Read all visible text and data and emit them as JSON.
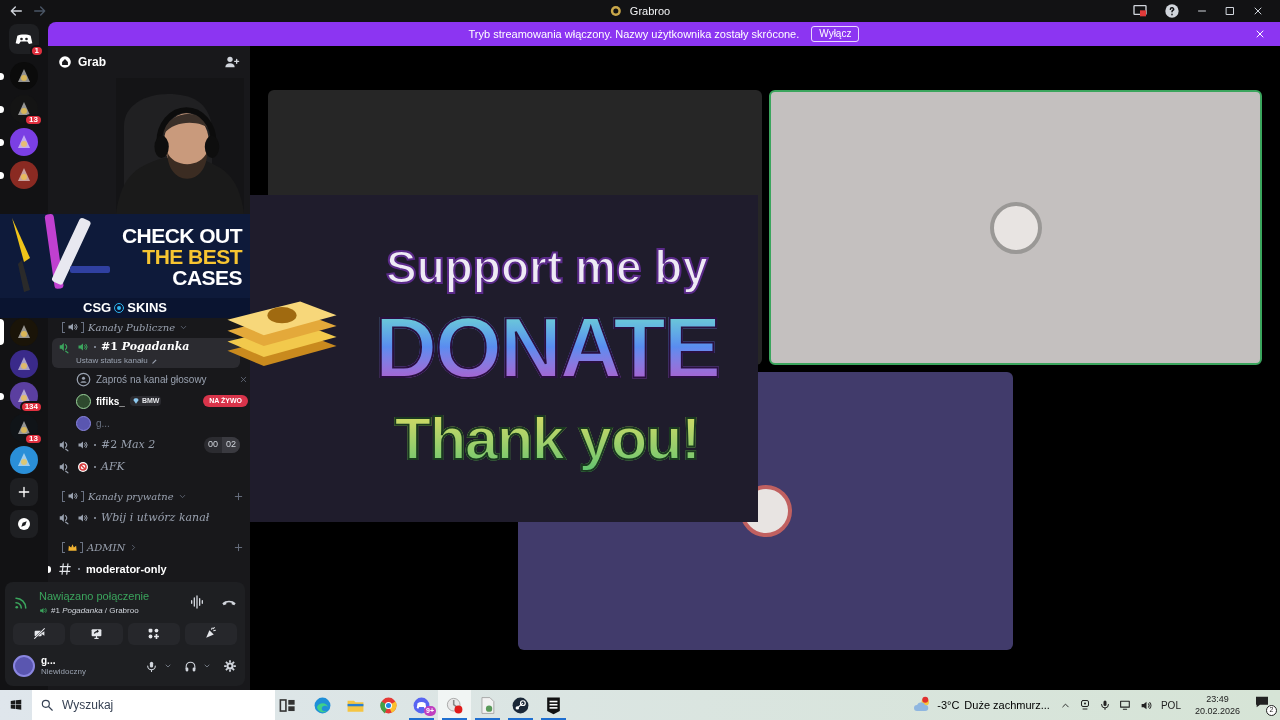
{
  "titlebar": {
    "title": "Grabroo"
  },
  "banner": {
    "text": "Tryb streamowania włączony. Nazwy użytkownika zostały skrócone.",
    "button": "Wyłącz"
  },
  "server_rail": {
    "top": [
      {
        "kind": "home",
        "badge": "1",
        "unread": false,
        "selected": false,
        "color": "#1e1f22"
      },
      {
        "kind": "server",
        "unread": true,
        "selected": false,
        "color": "#0b0b0b"
      },
      {
        "kind": "server",
        "badge": "13",
        "unread": true,
        "selected": false,
        "color": "#141414"
      },
      {
        "kind": "server",
        "unread": true,
        "selected": false,
        "color": "#7b3fe4"
      },
      {
        "kind": "server",
        "unread": true,
        "selected": false,
        "color": "#8a2a22"
      }
    ],
    "bottom": [
      {
        "kind": "server",
        "unread": false,
        "selected": true,
        "color": "#1a1408"
      },
      {
        "kind": "server",
        "unread": false,
        "selected": false,
        "color": "#3a2a8a"
      },
      {
        "kind": "server",
        "badge": "134",
        "unread": true,
        "selected": false,
        "color": "#5b3fa0"
      },
      {
        "kind": "server",
        "badge": "13",
        "unread": false,
        "selected": false,
        "color": "#101418"
      },
      {
        "kind": "server",
        "unread": false,
        "selected": false,
        "color": "#2a8fd8"
      },
      {
        "kind": "add"
      },
      {
        "kind": "explore"
      }
    ]
  },
  "server_header": {
    "title": "Grab"
  },
  "ad_overlay": {
    "lines": [
      "CHECK OUT",
      "THE BEST",
      "CASES"
    ],
    "brand_left": "CSG",
    "brand_right": "SKINS"
  },
  "channels": [
    {
      "kind": "category",
      "name": "Kanały Publiczne",
      "expanded": true,
      "addable": false
    },
    {
      "kind": "voice",
      "name": "#1 *Pogadanka*",
      "status": "Ustaw status kanału",
      "selected": true
    },
    {
      "kind": "invite",
      "name": "Zaproś na kanał głosowy"
    },
    {
      "kind": "member",
      "name": "fifiks_",
      "tag": "BMW",
      "live": "NA ŻYWO"
    },
    {
      "kind": "member",
      "name": "g..."
    },
    {
      "kind": "voice",
      "name": "#2 *Max 2*",
      "counters": [
        "00",
        "02"
      ],
      "selected": false
    },
    {
      "kind": "afk",
      "name": "*AFK*",
      "selected": false
    },
    {
      "kind": "category",
      "name": "Kanały prywatne",
      "expanded": true,
      "addable": true
    },
    {
      "kind": "voice",
      "name": "*Wbij i utwórz kanał*",
      "selected": false
    },
    {
      "kind": "category",
      "name": "ADMIN",
      "expanded": false,
      "addable": true
    },
    {
      "kind": "text",
      "name": "moderator-only",
      "unread": true
    }
  ],
  "voice_panel": {
    "status": "Nawiązano połączenie",
    "channel": "#1 *Pogadanka* / Grabroo",
    "user": {
      "name": "g...",
      "status": "Niewidoczny"
    }
  },
  "tiles": [
    {
      "kind": "screen",
      "speaking": false,
      "color": "#262626"
    },
    {
      "kind": "avatar",
      "speaking": true,
      "color": "#c4c0bf"
    },
    {
      "kind": "avatar",
      "speaking": false,
      "color": "#413b6b"
    }
  ],
  "donate_overlay": {
    "lines": [
      "Support me by",
      "DONATE",
      "Thank you!"
    ]
  },
  "taskbar": {
    "search": "Wyszukaj",
    "apps": [
      {
        "kind": "taskview",
        "running": false,
        "active": false
      },
      {
        "kind": "edge",
        "running": false,
        "active": false
      },
      {
        "kind": "explorer",
        "running": false,
        "active": false
      },
      {
        "kind": "chrome",
        "running": false,
        "active": false
      },
      {
        "kind": "discord",
        "badge": "9+",
        "running": true,
        "active": false
      },
      {
        "kind": "recorder",
        "running": true,
        "active": true
      },
      {
        "kind": "file",
        "running": true,
        "active": false
      },
      {
        "kind": "steam",
        "running": true,
        "active": false
      },
      {
        "kind": "epic",
        "running": true,
        "active": false
      }
    ],
    "weather": {
      "temp": "-3°C",
      "text": "Duże zachmurz..."
    },
    "language": "POL",
    "time": "23:49",
    "date": "20.02.2026",
    "notifications": "2"
  }
}
